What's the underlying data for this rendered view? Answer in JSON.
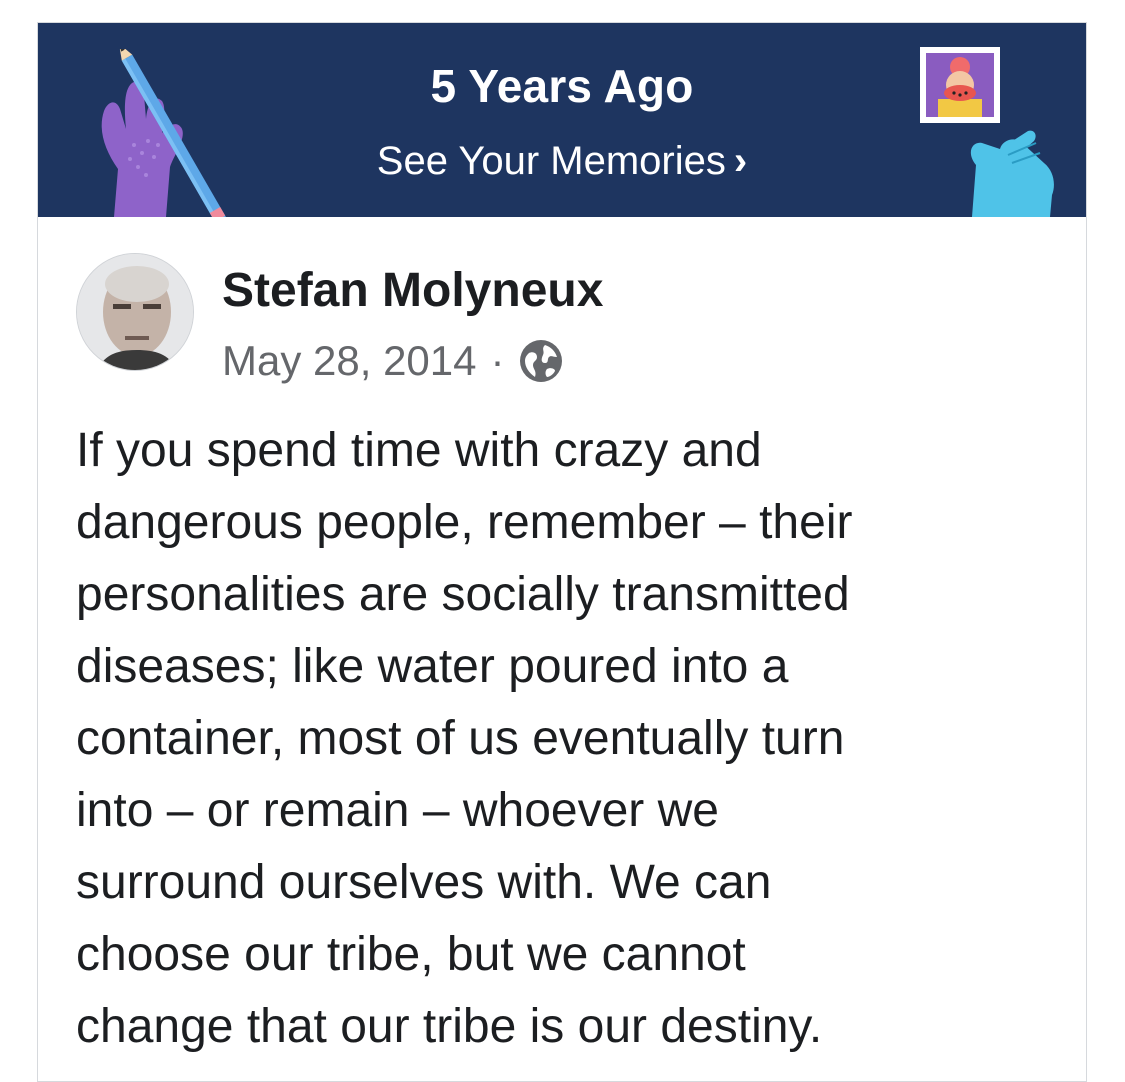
{
  "memories_banner": {
    "title": "5 Years Ago",
    "link_label": "See Your Memories",
    "chevron": "›",
    "background_color": "#1e3560",
    "left_illustration_icon": "hand-holding-pencil-icon",
    "right_illustration_icon": "hand-holding-photo-icon"
  },
  "post": {
    "author": "Stefan Molyneux",
    "date": "May 28, 2014",
    "separator": "·",
    "privacy_icon": "globe-icon",
    "body_lines": [
      "If you spend time with crazy and",
      "dangerous people, remember – their",
      "personalities are socially transmitted",
      "diseases; like water poured into a",
      "container, most of us eventually turn",
      "into – or remain – whoever we",
      "surround ourselves with. We can",
      "choose our tribe, but we cannot",
      "change that our tribe is our destiny."
    ]
  }
}
